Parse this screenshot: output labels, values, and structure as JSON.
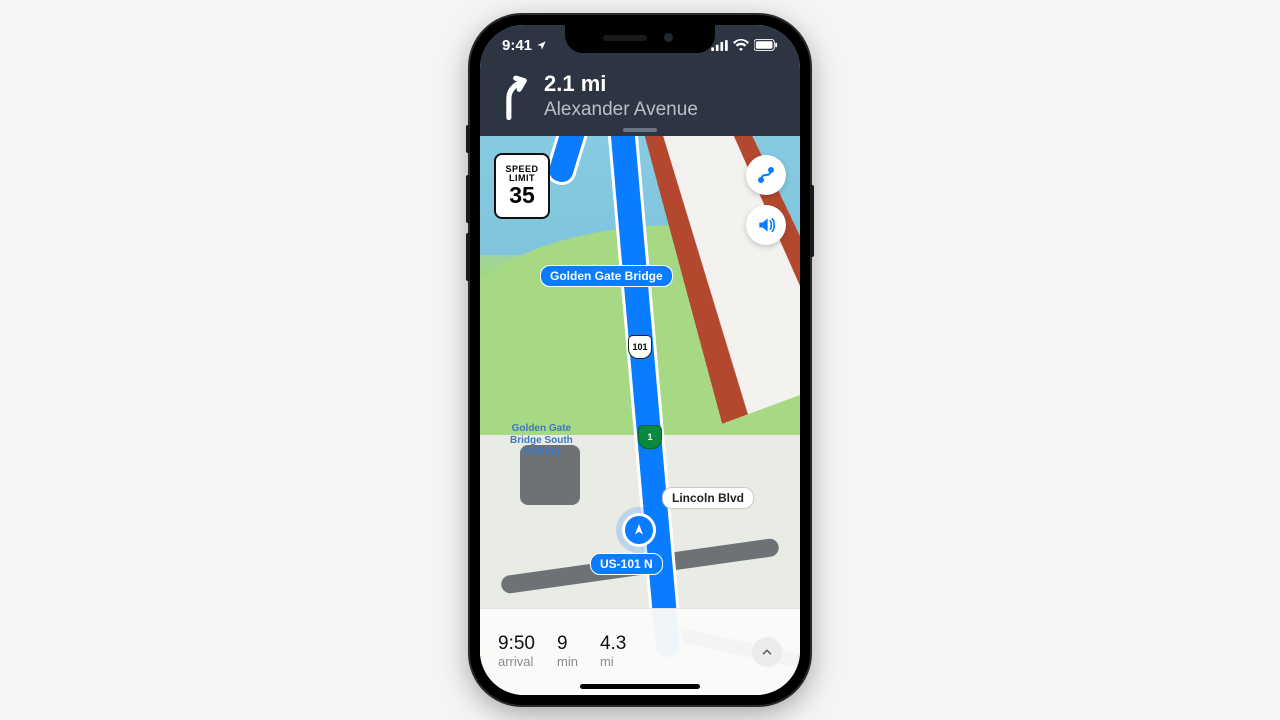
{
  "status": {
    "time": "9:41"
  },
  "nav": {
    "distance": "2.1 mi",
    "street": "Alexander Avenue"
  },
  "speed_sign": {
    "line1": "SPEED",
    "line2": "LIMIT",
    "value": "35"
  },
  "map_labels": {
    "bridge": "Golden Gate Bridge",
    "parking": "Golden Gate\nBridge South\nParking",
    "lincoln": "Lincoln Blvd",
    "us101": "US-101 N",
    "shield101": "101",
    "shield1": "1"
  },
  "bottom": {
    "arrival_value": "9:50",
    "arrival_label": "arrival",
    "duration_value": "9",
    "duration_label": "min",
    "distance_value": "4.3",
    "distance_label": "mi"
  }
}
